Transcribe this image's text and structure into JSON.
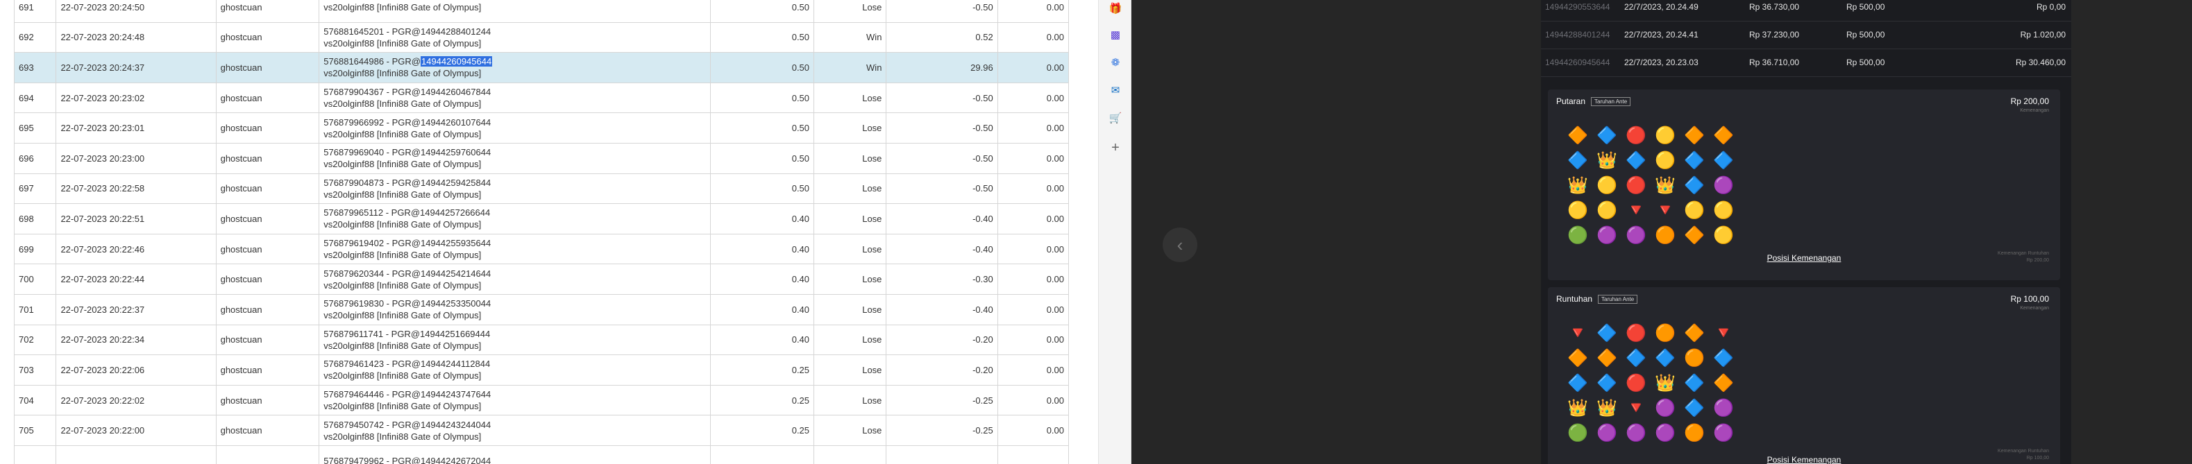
{
  "bets_table": {
    "rows": [
      {
        "no": "691",
        "date": "22-07-2023 20:24:50",
        "user": "ghostcuan",
        "tx_before": "",
        "tx_hl": "",
        "tx_after": "",
        "tx_line1": "",
        "game": "vs20olginf88 [Infini88 Gate of Olympus]",
        "bet": "0.50",
        "result": "Lose",
        "win": "-0.50",
        "jp": "0.00"
      },
      {
        "no": "692",
        "date": "22-07-2023 20:24:48",
        "user": "ghostcuan",
        "tx_before": "",
        "tx_hl": "",
        "tx_after": "",
        "tx_line1": "576881645201 - PGR@14944288401244",
        "game": "vs20olginf88 [Infini88 Gate of Olympus]",
        "bet": "0.50",
        "result": "Win",
        "win": "0.52",
        "jp": "0.00"
      },
      {
        "no": "693",
        "date": "22-07-2023 20:24:37",
        "user": "ghostcuan",
        "tx_before": "576881644986 - PGR@",
        "tx_hl": "14944260945644",
        "tx_after": "",
        "tx_line1": "",
        "game": "vs20olginf88 [Infini88 Gate of Olympus]",
        "bet": "0.50",
        "result": "Win",
        "win": "29.96",
        "jp": "0.00"
      },
      {
        "no": "694",
        "date": "22-07-2023 20:23:02",
        "user": "ghostcuan",
        "tx_before": "",
        "tx_hl": "",
        "tx_after": "",
        "tx_line1": "576879904367 - PGR@14944260467844",
        "game": "vs20olginf88 [Infini88 Gate of Olympus]",
        "bet": "0.50",
        "result": "Lose",
        "win": "-0.50",
        "jp": "0.00"
      },
      {
        "no": "695",
        "date": "22-07-2023 20:23:01",
        "user": "ghostcuan",
        "tx_before": "",
        "tx_hl": "",
        "tx_after": "",
        "tx_line1": "576879966992 - PGR@14944260107644",
        "game": "vs20olginf88 [Infini88 Gate of Olympus]",
        "bet": "0.50",
        "result": "Lose",
        "win": "-0.50",
        "jp": "0.00"
      },
      {
        "no": "696",
        "date": "22-07-2023 20:23:00",
        "user": "ghostcuan",
        "tx_before": "",
        "tx_hl": "",
        "tx_after": "",
        "tx_line1": "576879969040 - PGR@14944259760644",
        "game": "vs20olginf88 [Infini88 Gate of Olympus]",
        "bet": "0.50",
        "result": "Lose",
        "win": "-0.50",
        "jp": "0.00"
      },
      {
        "no": "697",
        "date": "22-07-2023 20:22:58",
        "user": "ghostcuan",
        "tx_before": "",
        "tx_hl": "",
        "tx_after": "",
        "tx_line1": "576879904873 - PGR@14944259425844",
        "game": "vs20olginf88 [Infini88 Gate of Olympus]",
        "bet": "0.50",
        "result": "Lose",
        "win": "-0.50",
        "jp": "0.00"
      },
      {
        "no": "698",
        "date": "22-07-2023 20:22:51",
        "user": "ghostcuan",
        "tx_before": "",
        "tx_hl": "",
        "tx_after": "",
        "tx_line1": "576879965112 - PGR@14944257266644",
        "game": "vs20olginf88 [Infini88 Gate of Olympus]",
        "bet": "0.40",
        "result": "Lose",
        "win": "-0.40",
        "jp": "0.00"
      },
      {
        "no": "699",
        "date": "22-07-2023 20:22:46",
        "user": "ghostcuan",
        "tx_before": "",
        "tx_hl": "",
        "tx_after": "",
        "tx_line1": "576879619402 - PGR@14944255935644",
        "game": "vs20olginf88 [Infini88 Gate of Olympus]",
        "bet": "0.40",
        "result": "Lose",
        "win": "-0.40",
        "jp": "0.00"
      },
      {
        "no": "700",
        "date": "22-07-2023 20:22:44",
        "user": "ghostcuan",
        "tx_before": "",
        "tx_hl": "",
        "tx_after": "",
        "tx_line1": "576879620344 - PGR@14944254214644",
        "game": "vs20olginf88 [Infini88 Gate of Olympus]",
        "bet": "0.40",
        "result": "Lose",
        "win": "-0.30",
        "jp": "0.00"
      },
      {
        "no": "701",
        "date": "22-07-2023 20:22:37",
        "user": "ghostcuan",
        "tx_before": "",
        "tx_hl": "",
        "tx_after": "",
        "tx_line1": "576879619830 - PGR@14944253350044",
        "game": "vs20olginf88 [Infini88 Gate of Olympus]",
        "bet": "0.40",
        "result": "Lose",
        "win": "-0.40",
        "jp": "0.00"
      },
      {
        "no": "702",
        "date": "22-07-2023 20:22:34",
        "user": "ghostcuan",
        "tx_before": "",
        "tx_hl": "",
        "tx_after": "",
        "tx_line1": "576879611741 - PGR@14944251669444",
        "game": "vs20olginf88 [Infini88 Gate of Olympus]",
        "bet": "0.40",
        "result": "Lose",
        "win": "-0.20",
        "jp": "0.00"
      },
      {
        "no": "703",
        "date": "22-07-2023 20:22:06",
        "user": "ghostcuan",
        "tx_before": "",
        "tx_hl": "",
        "tx_after": "",
        "tx_line1": "576879461423 - PGR@14944244112844",
        "game": "vs20olginf88 [Infini88 Gate of Olympus]",
        "bet": "0.25",
        "result": "Lose",
        "win": "-0.20",
        "jp": "0.00"
      },
      {
        "no": "704",
        "date": "22-07-2023 20:22:02",
        "user": "ghostcuan",
        "tx_before": "",
        "tx_hl": "",
        "tx_after": "",
        "tx_line1": "576879464446 - PGR@14944243747644",
        "game": "vs20olginf88 [Infini88 Gate of Olympus]",
        "bet": "0.25",
        "result": "Lose",
        "win": "-0.25",
        "jp": "0.00"
      },
      {
        "no": "705",
        "date": "22-07-2023 20:22:00",
        "user": "ghostcuan",
        "tx_before": "",
        "tx_hl": "",
        "tx_after": "",
        "tx_line1": "576879450742 - PGR@14944243244044",
        "game": "vs20olginf88 [Infini88 Gate of Olympus]",
        "bet": "0.25",
        "result": "Lose",
        "win": "-0.25",
        "jp": "0.00"
      },
      {
        "no": "",
        "date": "",
        "user": "",
        "tx_before": "",
        "tx_hl": "",
        "tx_after": "",
        "tx_line1": "576879479962 - PGR@14944242672044",
        "game": "",
        "bet": "",
        "result": "",
        "win": "",
        "jp": ""
      }
    ]
  },
  "side_strip": {
    "icons": [
      "gift-icon",
      "chart-app-icon",
      "copilot-icon",
      "outlook-icon",
      "shopping-icon",
      "plus-icon"
    ]
  },
  "history": {
    "rows": [
      {
        "id": "14944290553644",
        "datetime": "22/7/2023, 20.24.49",
        "balance": "Rp 36.730,00",
        "bet": "Rp 500,00",
        "win": "Rp 0,00"
      },
      {
        "id": "14944288401244",
        "datetime": "22/7/2023, 20.24.41",
        "balance": "Rp 37.230,00",
        "bet": "Rp 500,00",
        "win": "Rp 1.020,00"
      },
      {
        "id": "14944260945644",
        "datetime": "22/7/2023, 20.23.03",
        "balance": "Rp 36.710,00",
        "bet": "Rp 500,00",
        "win": "Rp 30.460,00"
      }
    ],
    "cards": [
      {
        "title": "Putaran",
        "tag": "Taruhan Ante",
        "amount": "Rp 200,00",
        "amount_sub": "Kemenangan",
        "grid": [
          [
            "🔶",
            "🔷",
            "🔴",
            "🟡",
            "🔶",
            "🔶"
          ],
          [
            "🔷",
            "👑",
            "🔷",
            "🟡",
            "🔷",
            "🔷"
          ],
          [
            "👑",
            "🟡",
            "🔴",
            "👑",
            "🔷",
            "🟣"
          ],
          [
            "🟡",
            "🟡",
            "🔻",
            "🔻",
            "🟡",
            "🟡"
          ],
          [
            "🟢",
            "🟣",
            "🟣",
            "🟠",
            "🔶",
            "🟡"
          ]
        ],
        "pos_label": "Posisi Kemenangan",
        "win_info_1": "Kemenangan Runtuhan",
        "win_info_2": "Rp 200,00"
      },
      {
        "title": "Runtuhan",
        "tag": "Taruhan Ante",
        "amount": "Rp 100,00",
        "amount_sub": "Kemenangan",
        "grid": [
          [
            "🔻",
            "🔷",
            "🔴",
            "🟠",
            "🔶",
            "🔻"
          ],
          [
            "🔶",
            "🔶",
            "🔷",
            "🔷",
            "🟠",
            "🔷"
          ],
          [
            "🔷",
            "🔷",
            "🔴",
            "👑",
            "🔷",
            "🔶"
          ],
          [
            "👑",
            "👑",
            "🔻",
            "🟣",
            "🔷",
            "🟣"
          ],
          [
            "🟢",
            "🟣",
            "🟣",
            "🟣",
            "🟠",
            "🟣"
          ]
        ],
        "pos_label": "Posisi Kemenangan",
        "win_info_1": "Kemenangan Runtuhan",
        "win_info_2": "Rp 100,00"
      }
    ]
  },
  "colors": {
    "lose": "#e0342b",
    "win": "#35a63a",
    "highlight": "#2f6fe0",
    "selected_row": "#d6eaf2"
  }
}
